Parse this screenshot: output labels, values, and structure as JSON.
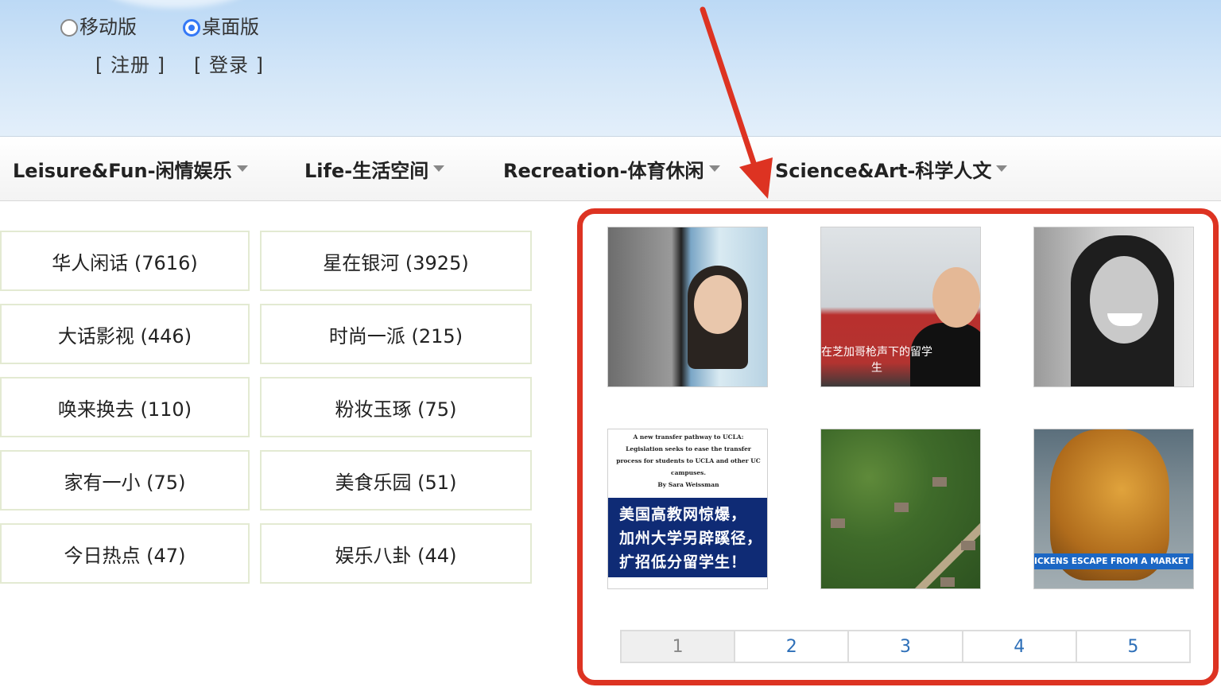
{
  "header": {
    "version_options": [
      {
        "label": "移动版",
        "checked": false
      },
      {
        "label": "桌面版",
        "checked": true
      }
    ],
    "register_label": "[ 注册 ]",
    "login_label": "[ 登录 ]"
  },
  "nav": {
    "items": [
      {
        "label": "Leisure&Fun-闲情娱乐"
      },
      {
        "label": "Life-生活空间"
      },
      {
        "label": "Recreation-体育休闲"
      },
      {
        "label": "Science&Art-科学人文"
      }
    ]
  },
  "forums": {
    "left": [
      {
        "label": "华人闲话 (7616)"
      },
      {
        "label": "大话影视 (446)"
      },
      {
        "label": "唤来换去 (110)"
      },
      {
        "label": "家有一小 (75)"
      },
      {
        "label": "今日热点 (47)"
      }
    ],
    "right": [
      {
        "label": "星在银河 (3925)"
      },
      {
        "label": "时尚一派 (215)"
      },
      {
        "label": "粉妆玉琢 (75)"
      },
      {
        "label": "美食乐园 (51)"
      },
      {
        "label": "娱乐八卦 (44)"
      }
    ]
  },
  "photos": {
    "items": [
      {
        "icon": "portrait-photo"
      },
      {
        "icon": "student-photo",
        "caption": "在芝加哥枪声下的留学生"
      },
      {
        "icon": "smiling-woman-photo"
      },
      {
        "icon": "article-photo",
        "article_text": "A new transfer pathway to UCLA: Legislation seeks to ease the transfer process for students to UCLA and other UC campuses.",
        "article_byline": "By Sara Weissman",
        "headline_lines": [
          "美国高教网惊爆，",
          "加州大学另辟蹊径，",
          "扩招低分留学生！"
        ]
      },
      {
        "icon": "aerial-forest-photo"
      },
      {
        "icon": "chicken-photo",
        "banner": "ICKENS ESCAPE FROM A MARKET"
      }
    ]
  },
  "pagination": {
    "pages": [
      "1",
      "2",
      "3",
      "4",
      "5"
    ],
    "active": "1"
  },
  "annotation": {
    "color": "#dd3322"
  }
}
